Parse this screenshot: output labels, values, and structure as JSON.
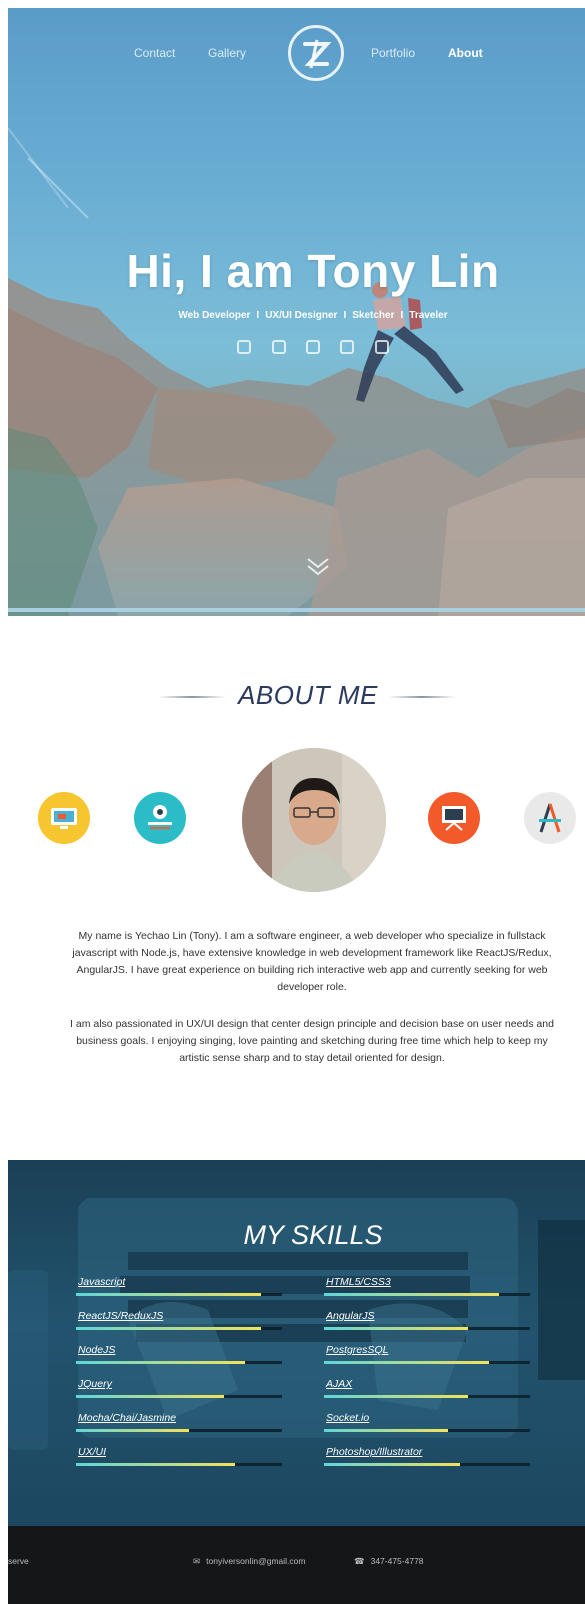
{
  "nav": {
    "items": [
      {
        "label": "Contact"
      },
      {
        "label": "Gallery"
      },
      {
        "label": "Portfolio"
      },
      {
        "label": "About"
      }
    ]
  },
  "hero": {
    "title": "Hi, I am Tony Lin",
    "roles": [
      "Web Developer",
      "UX/UI Designer",
      "Sketcher",
      "Traveler"
    ],
    "separator": "I",
    "socials": [
      "linkedin-icon",
      "github-icon",
      "facebook-icon",
      "youtube-icon",
      "twitter-icon"
    ]
  },
  "about": {
    "title": "ABOUT ME",
    "paragraph1": "My name is Yechao Lin (Tony). I am a software engineer, a web developer who specialize in fullstack javascript with Node.js, have extensive knowledge in web development framework like ReactJS/Redux, AngularJS. I have great experience on building rich interactive web app and currently seeking for web developer role.",
    "paragraph2": "I am also passionated in UX/UI design that center design principle and decision base on user needs and business goals. I enjoying singing, love painting and sketching during free time which help to keep my artistic sense sharp and to stay detail oriented for design.",
    "icons": [
      {
        "name": "web-design-icon",
        "color": "#f7c530"
      },
      {
        "name": "settings-monitor-icon",
        "color": "#2bbcc8"
      },
      {
        "name": "presentation-easel-icon",
        "color": "#f25a2a"
      },
      {
        "name": "design-tools-icon",
        "color": "#e9e9e9"
      }
    ]
  },
  "skills": {
    "title": "MY SKILLS",
    "left": [
      {
        "name": "Javascript",
        "level": 0.9
      },
      {
        "name": "ReactJS/ReduxJS",
        "level": 0.9
      },
      {
        "name": "NodeJS",
        "level": 0.82
      },
      {
        "name": "JQuery",
        "level": 0.72
      },
      {
        "name": "Mocha/Chai/Jasmine",
        "level": 0.55
      },
      {
        "name": "UX/UI",
        "level": 0.77
      }
    ],
    "right": [
      {
        "name": "HTML5/CSS3",
        "level": 0.85
      },
      {
        "name": "AngularJS",
        "level": 0.7
      },
      {
        "name": "PostgresSQL",
        "level": 0.8
      },
      {
        "name": "AJAX",
        "level": 0.7
      },
      {
        "name": "Socket.io",
        "level": 0.6
      },
      {
        "name": "Photoshop/Illustrator",
        "level": 0.66
      }
    ],
    "colors": {
      "start": "#5fd6d8",
      "end": "#f3e25a"
    }
  },
  "footer": {
    "left_text": "serve",
    "email": "tonyiversonlin@gmail.com",
    "phone": "347-475-4778"
  }
}
